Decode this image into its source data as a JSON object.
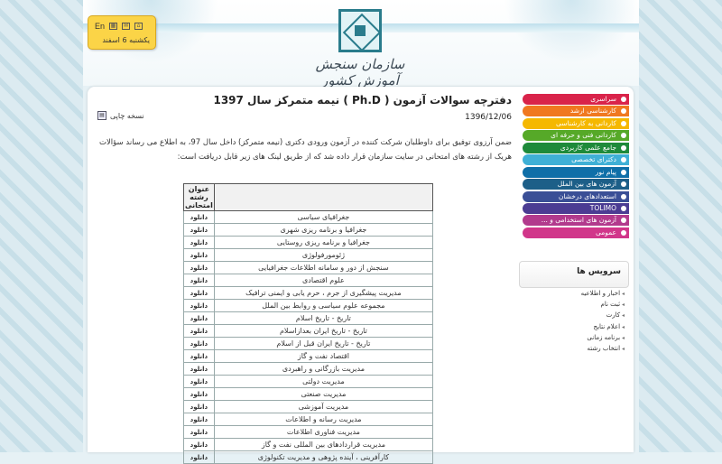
{
  "header": {
    "logo_text": "سازمان سنجش آموزش کشور"
  },
  "toolbox": {
    "lang_label": "En",
    "date": "یکشنبه 6 اسفند"
  },
  "article": {
    "title": "دفترچه سوالات آزمون ( Ph.D ) نیمه متمرکز سال 1397",
    "date": "1396/12/06",
    "print_label": "نسخه چاپی",
    "intro": "ضمن آرزوی توفیق برای داوطلبان شرکت کننده در آزمون ورودی دکتری (نیمه متمرکز) داخل سال 97، به اطلاع می رساند سؤالات هریک از رشته های امتحانی در سایت سازمان قرار داده شد که از طریق لینک های زیر قابل دریافت است:"
  },
  "table": {
    "header": "عنوان رشته امتحانی",
    "download_label": "دانلود",
    "rows": [
      "جغرافیای سیاسی",
      "جغرافیا و برنامه ریزی شهری",
      "جغرافیا و برنامه ریزی روستایی",
      "ژئومورفولوژی",
      "سنجش از دور و سامانه اطلاعات جغرافیایی",
      "علوم اقتصادی",
      "مدیریت پیشگیری از جرم ، حرم یابی و ایمنی ترافیک",
      "مجموعه علوم سیاسی و روابط بین الملل",
      "تاریخ - تاریخ اسلام",
      "تاریخ - تاریخ ایران بعدازاسلام",
      "تاریخ - تاریخ ایران قبل از اسلام",
      "اقتصاد نفت و گاز",
      "مدیریت بازرگانی و راهبردی",
      "مدیریت دولتی",
      "مدیریت صنعتی",
      "مدیریت آموزشی",
      "مدیریت رسانه و اطلاعات",
      "مدیریت فناوری اطلاعات",
      "مدیریت قراردادهای بین المللی نفت و گاز",
      "کارآفرینی ، آینده پژوهی و مدیریت تکنولوژی"
    ]
  },
  "menu": {
    "items": [
      {
        "label": "سراسری",
        "color": "#d9234a"
      },
      {
        "label": "کارشناسی ارشد",
        "color": "#f07820"
      },
      {
        "label": "کاردانی به کارشناسی",
        "color": "#f5b800"
      },
      {
        "label": "کاردانی فنی و حرفه ای",
        "color": "#56a928"
      },
      {
        "label": "جامع علمی کاربردی",
        "color": "#1e8a3a"
      },
      {
        "label": "دکترای تخصصی",
        "color": "#3fb0d6"
      },
      {
        "label": "پیام نور",
        "color": "#0f6fa8"
      },
      {
        "label": "آزمون های بین الملل",
        "color": "#1d5f88"
      },
      {
        "label": "استعدادهای درخشان",
        "color": "#3a4f96"
      },
      {
        "label": "TOLIMO",
        "color": "#4b3c93"
      },
      {
        "label": "آزمون های استخدامی و ...",
        "color": "#b23a8d"
      },
      {
        "label": "عمومی",
        "color": "#d1368a"
      }
    ]
  },
  "services": {
    "title": "سرویس ها",
    "items": [
      "اخبار و اطلاعیه",
      "ثبت نام",
      "کارت",
      "اعلام نتایج",
      "برنامه زمانی",
      "انتخاب رشته"
    ]
  }
}
